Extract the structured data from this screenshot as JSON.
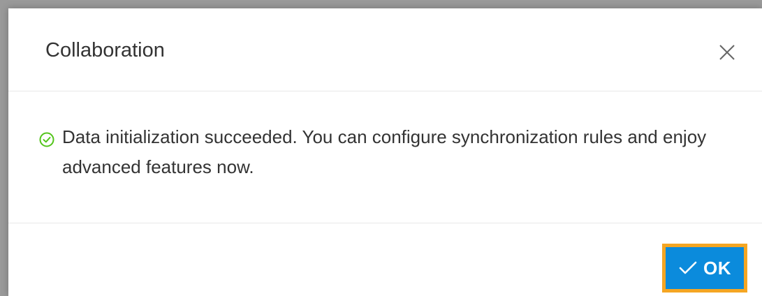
{
  "dialog": {
    "title": "Collaboration",
    "close_icon": "close-icon",
    "message": {
      "icon": "check-circle-icon",
      "icon_color": "#52c41a",
      "text": "Data initialization succeeded. You can configure synchronization rules and enjoy advanced features now."
    },
    "ok_button": {
      "icon": "check-icon",
      "label": "OK",
      "background": "#0b8bdc",
      "highlight_color": "#f5a623"
    }
  }
}
